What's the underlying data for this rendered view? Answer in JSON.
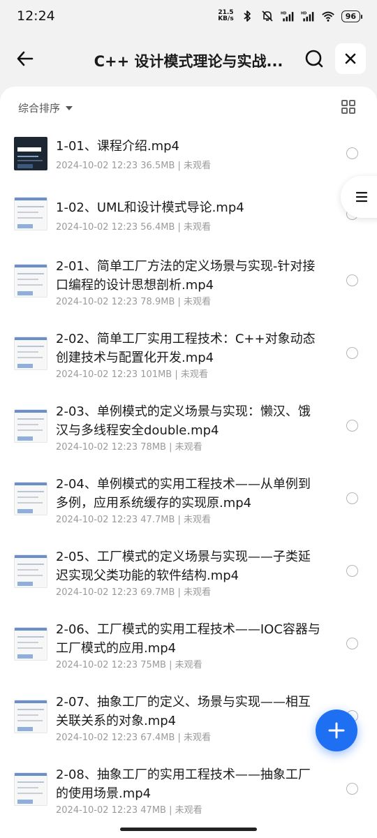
{
  "status_bar": {
    "time": "12:24",
    "net_speed_value": "21.5",
    "net_speed_unit": "KB/s",
    "battery": "96",
    "icons": [
      "bluetooth-icon",
      "mute-bell-icon",
      "hd-signal-icon",
      "hd-signal-icon",
      "wifi-icon",
      "battery-icon"
    ]
  },
  "header": {
    "title": "C++ 设计模式理论与实战...",
    "back_icon": "back-arrow-icon",
    "search_icon": "search-icon",
    "close_icon": "close-icon"
  },
  "toolbar": {
    "sort_label": "综合排序",
    "sort_icon": "caret-down-icon",
    "view_icon": "grid-view-icon"
  },
  "files": [
    {
      "title": "1-01、课程介绍.mp4",
      "meta": "2024-10-02 12:23  36.5MB | 未观看"
    },
    {
      "title": "1-02、UML和设计模式导论.mp4",
      "meta": "2024-10-02 12:23  56.4MB | 未观看"
    },
    {
      "title": "2-01、简单工厂方法的定义场景与实现-针对接口编程的设计思想剖析.mp4",
      "meta": "2024-10-02 12:23  78.9MB | 未观看"
    },
    {
      "title": "2-02、简单工厂实用工程技术：C++对象动态创建技术与配置化开发.mp4",
      "meta": "2024-10-02 12:23  101MB | 未观看"
    },
    {
      "title": "2-03、单例模式的定义场景与实现：懒汉、饿汉与多线程安全double.mp4",
      "meta": "2024-10-02 12:23  78MB | 未观看"
    },
    {
      "title": "2-04、单例模式的实用工程技术——从单例到多例，应用系统缓存的实现原.mp4",
      "meta": "2024-10-02 12:23  47.7MB | 未观看"
    },
    {
      "title": "2-05、工厂模式的定义场景与实现——子类延迟实现父类功能的软件结构.mp4",
      "meta": "2024-10-02 12:23  69.7MB | 未观看"
    },
    {
      "title": "2-06、工厂模式的实用工程技术——IOC容器与工厂模式的应用.mp4",
      "meta": "2024-10-02 12:23  75MB | 未观看"
    },
    {
      "title": "2-07、抽象工厂的定义、场景与实现——相互关联关系的对象.mp4",
      "meta": "2024-10-02 12:23  67.4MB | 未观看"
    },
    {
      "title": "2-08、抽象工厂的实用工程技术——抽象工厂的使用场景.mp4",
      "meta": "2024-10-02 12:23  47MB | 未观看"
    }
  ],
  "side_handle_icon": "menu-lines-icon",
  "fab_icon": "plus-icon",
  "accent_color": "#1f6ff2"
}
